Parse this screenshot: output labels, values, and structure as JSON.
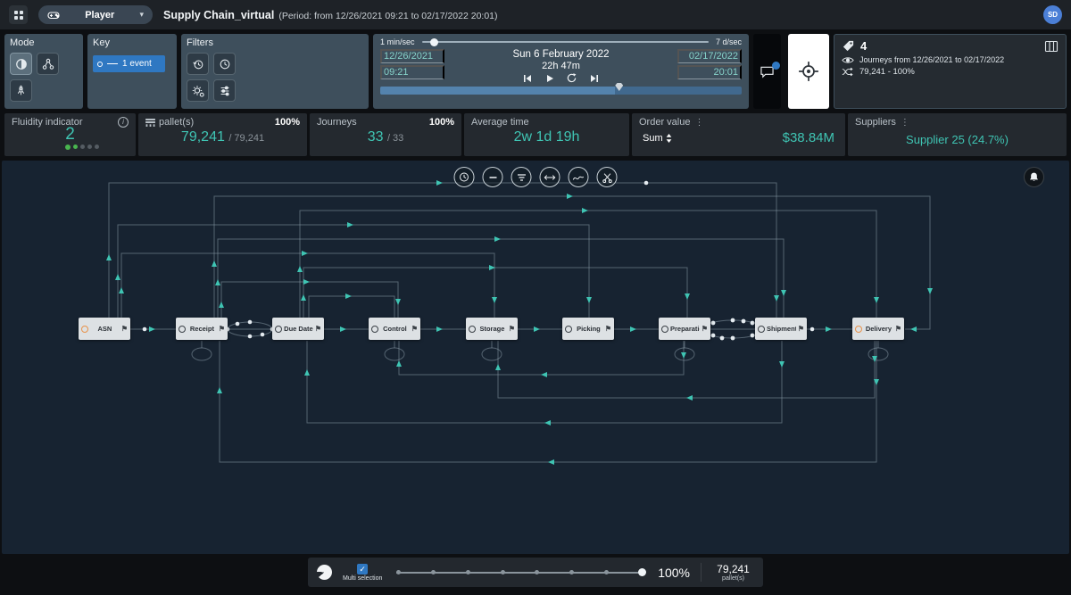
{
  "icons": {
    "kebab": "⋮",
    "flag": "⚑",
    "chevron_down": "▾",
    "check": "✓",
    "info": "i"
  },
  "topbar": {
    "player_label": "Player",
    "title": "Supply Chain_virtual",
    "period": "(Period: from 12/26/2021 09:21 to 02/17/2022 20:01)",
    "avatar": "SD"
  },
  "panels": {
    "mode": {
      "label": "Mode"
    },
    "key": {
      "label": "Key",
      "event_label": "1 event"
    },
    "filters": {
      "label": "Filters"
    },
    "timeline": {
      "speed_min": "1 min/sec",
      "speed_max": "7 d/sec",
      "start_date": "12/26/2021",
      "start_time": "09:21",
      "current_date": "Sun 6 February 2022",
      "elapsed": "22h 47m",
      "end_date": "02/17/2022",
      "end_time": "20:01"
    },
    "info": {
      "tag_count": "4",
      "journeys_text": "Journeys from 12/26/2021 to 02/17/2022",
      "pallets_text": "79,241 - 100%"
    }
  },
  "stats": {
    "fluidity": {
      "label": "Fluidity indicator",
      "value": "2"
    },
    "pallets": {
      "label": "pallet(s)",
      "percent": "100%",
      "value": "79,241",
      "total": "/ 79,241"
    },
    "journeys": {
      "label": "Journeys",
      "percent": "100%",
      "value": "33",
      "total": "/ 33"
    },
    "avg_time": {
      "label": "Average time",
      "value": "2w 1d 19h"
    },
    "order_value": {
      "label": "Order value",
      "agg": "Sum",
      "value": "$38.84M"
    },
    "suppliers": {
      "label": "Suppliers",
      "value": "Supplier 25 (24.7%)"
    }
  },
  "canvas": {
    "nodes": [
      {
        "label": "ASN"
      },
      {
        "label": "Receipt"
      },
      {
        "label": "Due Date"
      },
      {
        "label": "Control"
      },
      {
        "label": "Storage"
      },
      {
        "label": "Picking"
      },
      {
        "label": "Preparation"
      },
      {
        "label": "Shipment"
      },
      {
        "label": "Delivery"
      }
    ]
  },
  "bottombar": {
    "multi_selection": "Multi selection",
    "zoom": "100%",
    "count": "79,241",
    "count_unit": "pallet(s)"
  }
}
